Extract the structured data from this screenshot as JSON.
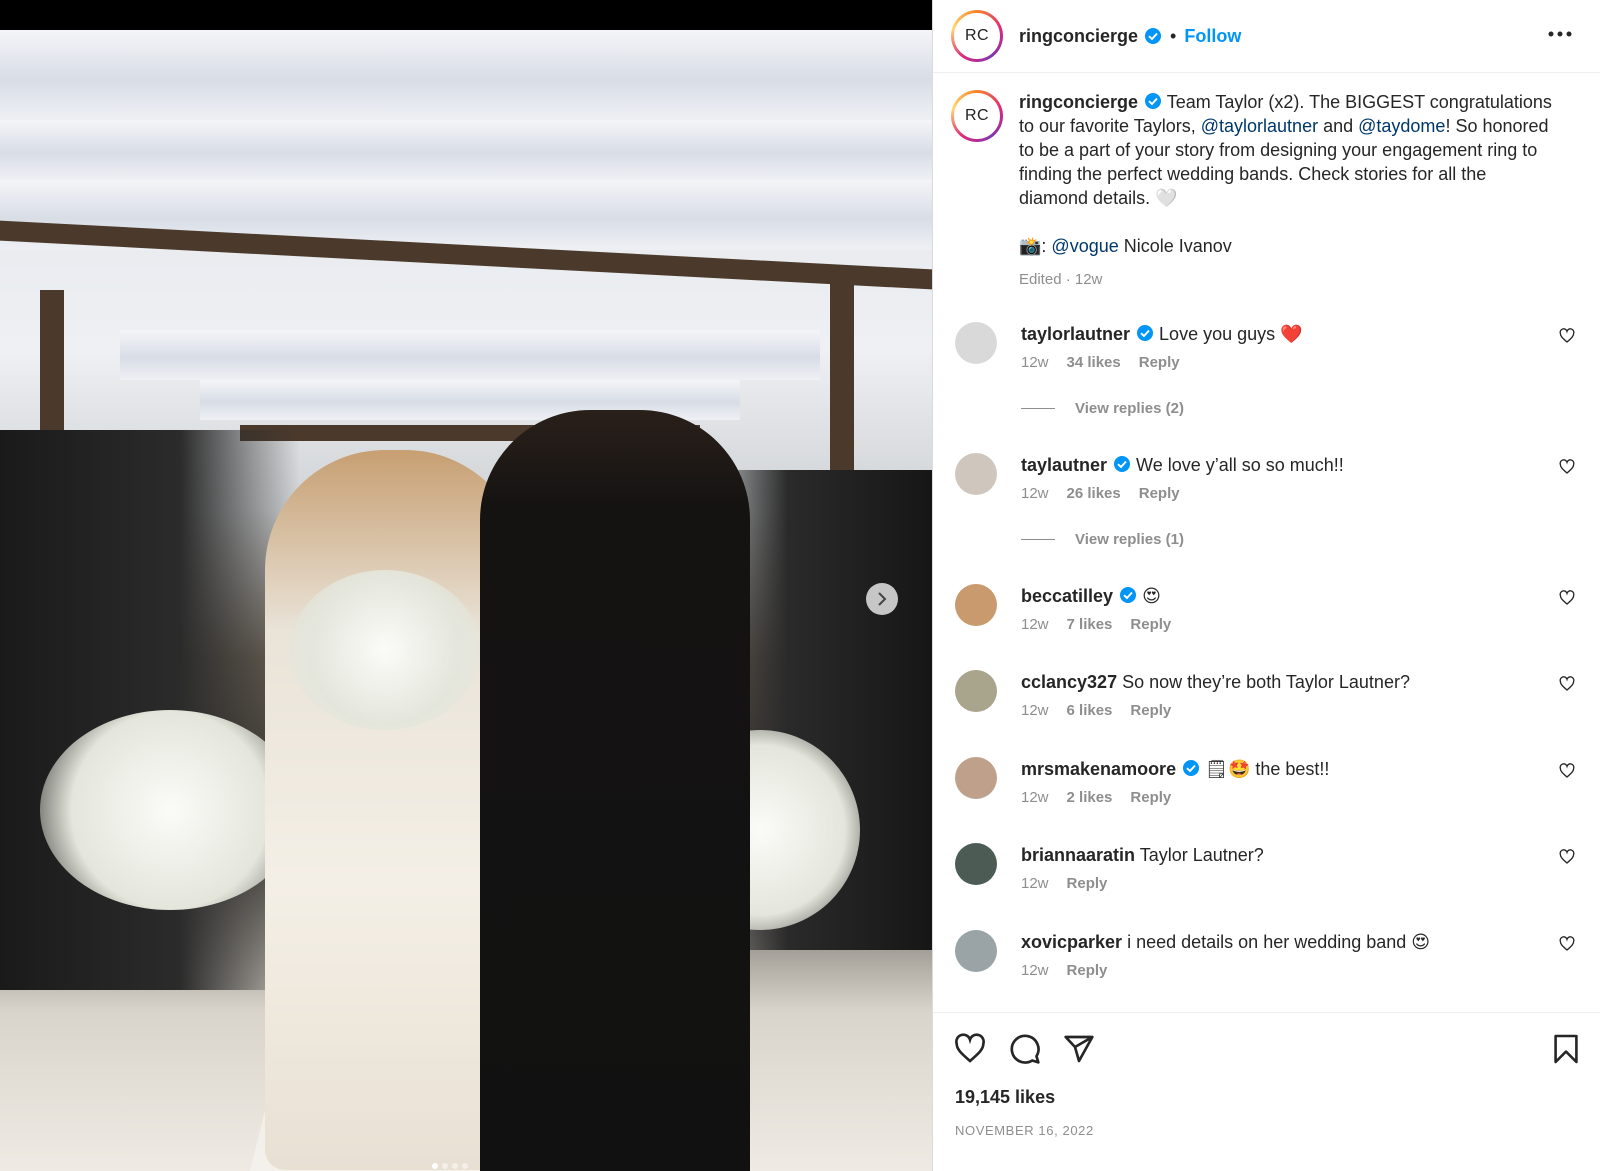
{
  "account": {
    "username": "ringconcierge",
    "avatar_text": "RC",
    "follow_label": "Follow",
    "separator": "•"
  },
  "caption": {
    "username": "ringconcierge",
    "text_1": " Team Taylor (x2). The BIGGEST congratulations to our favorite Taylors, ",
    "mention_1": "@taylorlautner",
    "text_2": " and ",
    "mention_2": "@taydome",
    "text_3": "! So honored to be a part of your story from designing your engagement ring to finding the perfect wedding bands. Check stories for all the diamond details. 🤍",
    "credit_prefix": "📸: ",
    "credit_mention": "@vogue",
    "credit_name": " Nicole Ivanov",
    "meta": "Edited · 12w"
  },
  "comments": [
    {
      "username": "taylorlautner",
      "verified": true,
      "text": "Love you guys ❤️",
      "time": "12w",
      "likes": "34 likes",
      "reply": "Reply",
      "view_replies": "View replies (2)",
      "avatar_color": "#d9d9d9"
    },
    {
      "username": "taylautner",
      "verified": true,
      "text": "We love y’all so so much!!",
      "time": "12w",
      "likes": "26 likes",
      "reply": "Reply",
      "view_replies": "View replies (1)",
      "avatar_color": "#cfc7bd"
    },
    {
      "username": "beccatilley",
      "verified": true,
      "text": "😍",
      "time": "12w",
      "likes": "7 likes",
      "reply": "Reply",
      "avatar_color": "#c99a6e"
    },
    {
      "username": "cclancy327",
      "verified": false,
      "text": "So now they’re both Taylor Lautner?",
      "time": "12w",
      "likes": "6 likes",
      "reply": "Reply",
      "avatar_color": "#a9a48c"
    },
    {
      "username": "mrsmakenamoore",
      "verified": true,
      "text": "🗒🤩 the best!!",
      "time": "12w",
      "likes": "2 likes",
      "reply": "Reply",
      "avatar_color": "#bfa08a"
    },
    {
      "username": "briannaaratin",
      "verified": false,
      "text": "Taylor Lautner?",
      "time": "12w",
      "likes": "",
      "reply": "Reply",
      "avatar_color": "#4c5b54"
    },
    {
      "username": "xovicparker",
      "verified": false,
      "text": "i need details on her wedding band 😍",
      "time": "12w",
      "likes": "",
      "reply": "Reply",
      "avatar_color": "#9aa3a6"
    }
  ],
  "footer": {
    "likes": "19,145 likes",
    "date": "NOVEMBER 16, 2022"
  },
  "colors": {
    "link": "#0095f6",
    "mention": "#00376b",
    "muted": "#8e8e8e",
    "verified": "#0095f6"
  },
  "icons": [
    "verified-badge-icon",
    "more-options-icon",
    "heart-icon",
    "comment-icon",
    "share-icon",
    "bookmark-icon",
    "chevron-right-icon"
  ]
}
